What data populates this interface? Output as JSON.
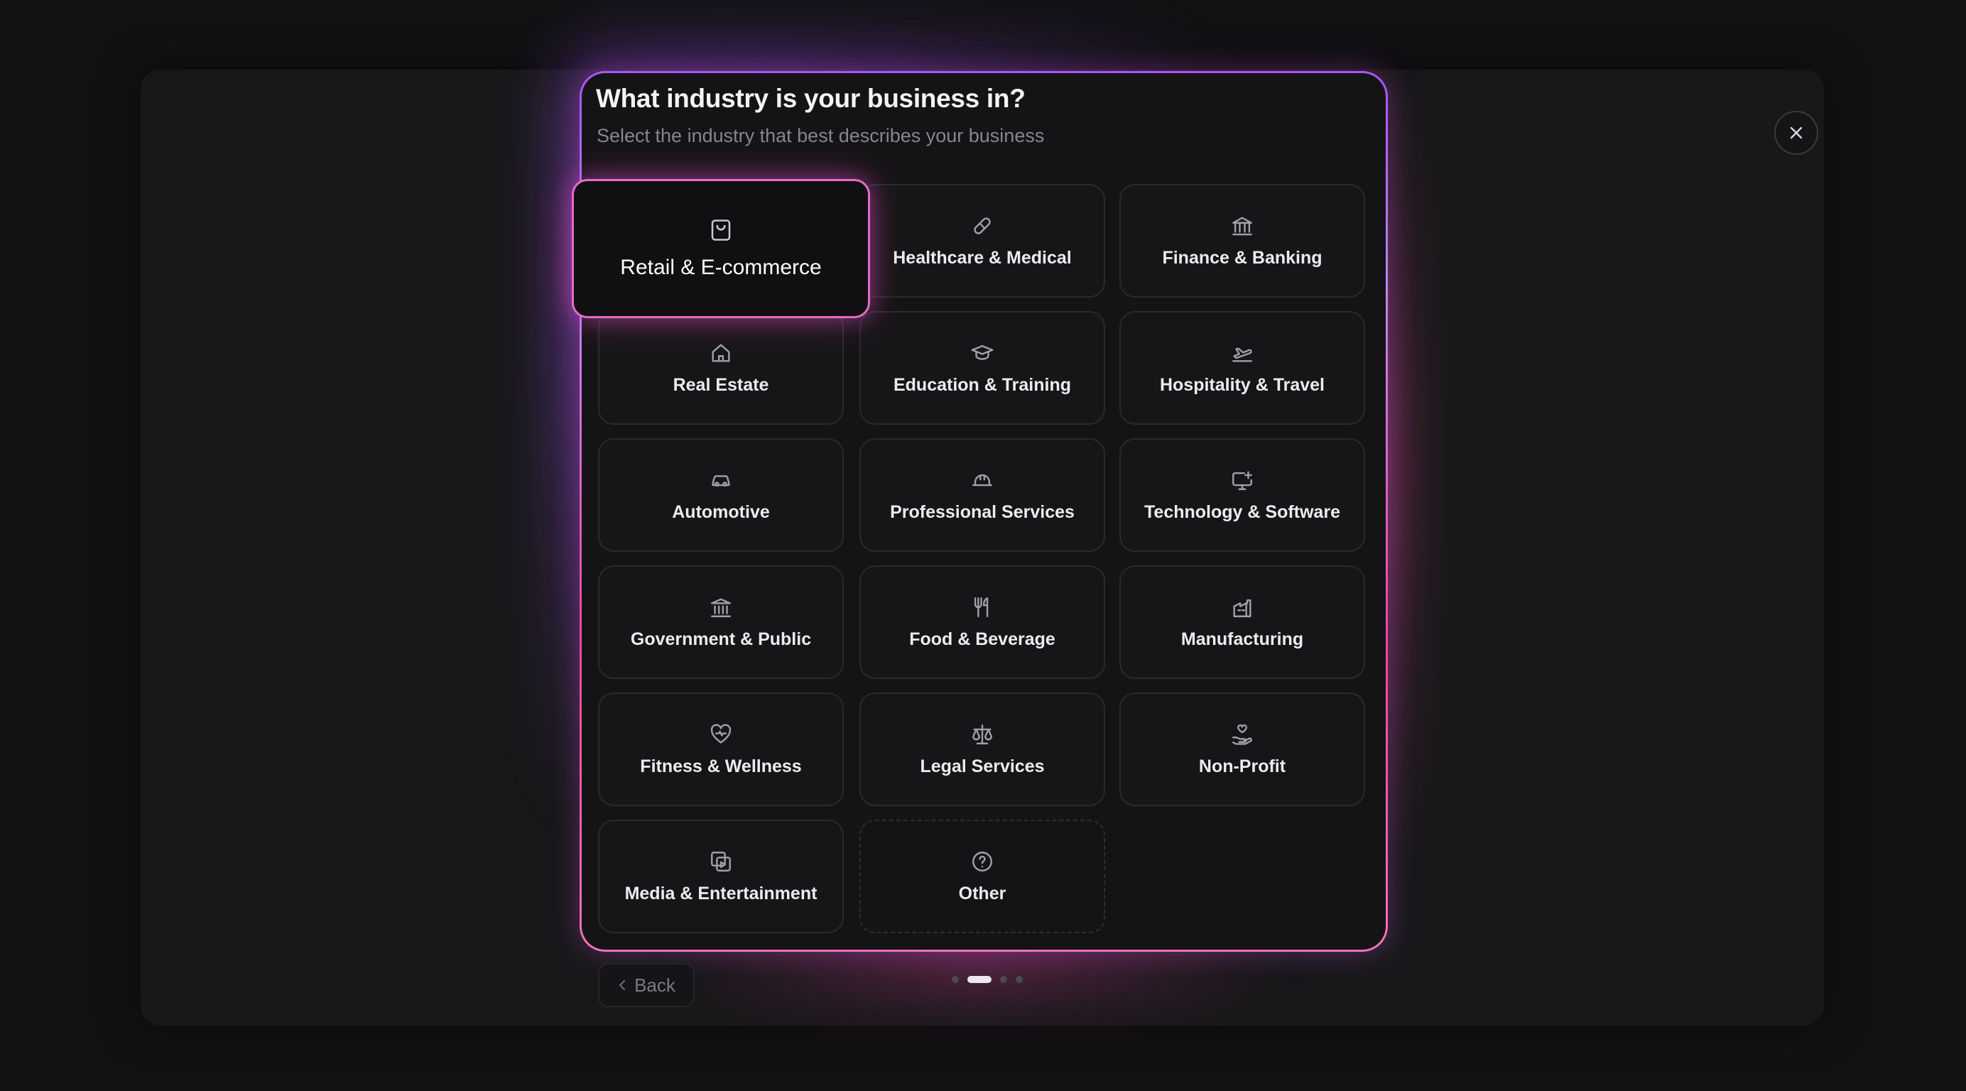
{
  "header": {
    "title": "What industry is your business in?",
    "subtitle": "Select the industry that best describes your business"
  },
  "industries": [
    {
      "label": "Retail & E-commerce",
      "icon": "shopping-bag-icon",
      "selected": true
    },
    {
      "label": "Healthcare & Medical",
      "icon": "pill-icon"
    },
    {
      "label": "Finance & Banking",
      "icon": "bank-icon"
    },
    {
      "label": "Real Estate",
      "icon": "house-icon"
    },
    {
      "label": "Education & Training",
      "icon": "graduation-cap-icon"
    },
    {
      "label": "Hospitality & Travel",
      "icon": "plane-icon"
    },
    {
      "label": "Automotive",
      "icon": "car-icon"
    },
    {
      "label": "Professional Services",
      "icon": "hard-hat-icon"
    },
    {
      "label": "Technology & Software",
      "icon": "monitor-plus-icon"
    },
    {
      "label": "Government & Public",
      "icon": "landmark-icon"
    },
    {
      "label": "Food & Beverage",
      "icon": "utensils-icon"
    },
    {
      "label": "Manufacturing",
      "icon": "factory-icon"
    },
    {
      "label": "Fitness & Wellness",
      "icon": "heart-pulse-icon"
    },
    {
      "label": "Legal Services",
      "icon": "scale-icon"
    },
    {
      "label": "Non-Profit",
      "icon": "hand-heart-icon"
    },
    {
      "label": "Media & Entertainment",
      "icon": "media-icon"
    },
    {
      "label": "Other",
      "icon": "help-circle-icon"
    }
  ],
  "footer": {
    "back_label": "Back",
    "pagination": {
      "total": 4,
      "current": 2
    }
  },
  "colors": {
    "accent_purple": "#a855f7",
    "accent_pink": "#ec4899",
    "background": "#121214",
    "card": "#161618"
  }
}
